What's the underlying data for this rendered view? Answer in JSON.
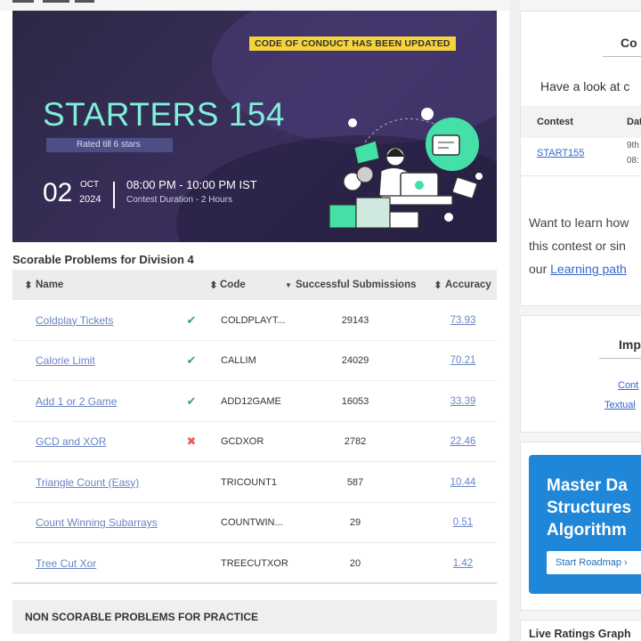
{
  "banner": {
    "notice": "CODE OF CONDUCT HAS BEEN UPDATED",
    "title": "STARTERS 154",
    "rated": "Rated till 6 stars",
    "day": "02",
    "month": "OCT",
    "year": "2024",
    "time": "08:00 PM - 10:00 PM IST",
    "duration": "Contest Duration - 2 Hours"
  },
  "problems": {
    "section_title": "Scorable Problems for Division 4",
    "headers": {
      "name": "Name",
      "code": "Code",
      "submissions": "Successful Submissions",
      "accuracy": "Accuracy"
    },
    "rows": [
      {
        "name": "Coldplay Tickets",
        "status": "solved",
        "code": "COLDPLAYT...",
        "submissions": "29143",
        "accuracy": "73.93"
      },
      {
        "name": "Calorie Limit",
        "status": "solved",
        "code": "CALLIM",
        "submissions": "24029",
        "accuracy": "70.21"
      },
      {
        "name": "Add 1 or 2 Game",
        "status": "solved",
        "code": "ADD12GAME",
        "submissions": "16053",
        "accuracy": "33.39"
      },
      {
        "name": "GCD and XOR",
        "status": "failed",
        "code": "GCDXOR",
        "submissions": "2782",
        "accuracy": "22.46"
      },
      {
        "name": "Triangle Count (Easy)",
        "status": "none",
        "code": "TRICOUNT1",
        "submissions": "587",
        "accuracy": "10.44"
      },
      {
        "name": "Count Winning Subarrays",
        "status": "none",
        "code": "COUNTWIN...",
        "submissions": "29",
        "accuracy": "0.51"
      },
      {
        "name": "Tree Cut Xor",
        "status": "none",
        "code": "TREECUTXOR",
        "submissions": "20",
        "accuracy": "1.42"
      }
    ],
    "nonscorable_title": "NON SCORABLE PROBLEMS FOR PRACTICE"
  },
  "sidebar": {
    "card1": {
      "heading": "Co",
      "look": "Have a look at c",
      "th_contest": "Contest",
      "th_date": "Dat",
      "contest_link": "START155",
      "date_line1": "9th",
      "date_line2": "08:",
      "learn_line1": "Want to learn how",
      "learn_line2": "this contest or sin",
      "learn_line3_prefix": "our ",
      "learn_link": "Learning path"
    },
    "card2": {
      "heading": "Imp",
      "link1": "Cont",
      "link2": "Textual"
    },
    "promo": {
      "line1": "Master Da",
      "line2": "Structures",
      "line3": "Algorithm",
      "button": "Start Roadmap  ›"
    },
    "card4": {
      "title": "Live Ratings Graph"
    }
  },
  "colors": {
    "accent": "#7ff0d8",
    "link": "#6a84c4",
    "notice": "#f5d33a",
    "promo": "#1f86d8"
  }
}
